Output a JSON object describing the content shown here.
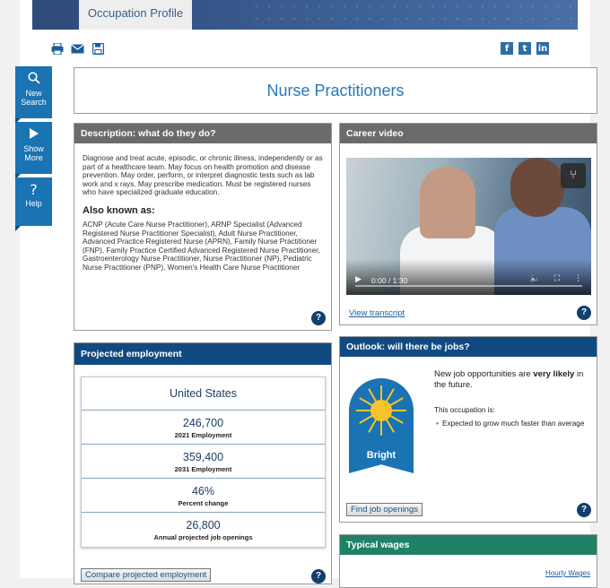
{
  "header": {
    "tab_label": "Occupation Profile"
  },
  "toolbar": {
    "left_icons": [
      "print-icon",
      "email-icon",
      "save-icon"
    ],
    "social": [
      "f",
      "t",
      "in"
    ]
  },
  "sidenav": [
    {
      "label_line1": "New",
      "label_line2": "Search",
      "icon": "search-icon"
    },
    {
      "label_line1": "Show",
      "label_line2": "More",
      "icon": "play-icon"
    },
    {
      "label_line1": "Help",
      "label_line2": "",
      "icon": "help-icon"
    }
  ],
  "page_title": "Nurse Practitioners",
  "description": {
    "heading": "Description: what do they do?",
    "text": "Diagnose and treat acute, episodic, or chronic illness, independently or as part of a healthcare team. May focus on health promotion and disease prevention. May order, perform, or interpret diagnostic tests such as lab work and x rays. May prescribe medication. Must be registered nurses who have specialized graduate education.",
    "aka_heading": "Also known as:",
    "aka_text": "ACNP (Acute Care Nurse Practitioner), ARNP Specialist (Advanced Registered Nurse Practitioner Specialist), Adult Nurse Practitioner, Advanced Practice Registered Nurse (APRN), Family Nurse Practitioner (FNP), Family Practice Certified Advanced Registered Nurse Practitioner, Gastroenterology Nurse Practitioner, Nurse Practitioner (NP), Pediatric Nurse Practitioner (PNP), Women's Health Care Nurse Practitioner"
  },
  "career_video": {
    "heading": "Career video",
    "time": "0:00 / 1:30",
    "transcript_link": "View transcript"
  },
  "projected": {
    "heading": "Projected employment",
    "region": "United States",
    "rows": [
      {
        "value": "246,700",
        "label": "2021 Employment"
      },
      {
        "value": "359,400",
        "label": "2031 Employment"
      },
      {
        "value": "46%",
        "label": "Percent change"
      },
      {
        "value": "26,800",
        "label": "Annual projected job openings"
      }
    ],
    "compare_button": "Compare projected employment"
  },
  "outlook": {
    "heading": "Outlook: will there be jobs?",
    "badge": "Bright",
    "text_pre": "New job opportunities are ",
    "text_bold": "very likely",
    "text_post": " in the future.",
    "sub": "This occupation is:",
    "bullet": "Expected to grow much faster than average",
    "find_button": "Find job openings"
  },
  "wages": {
    "heading": "Typical wages",
    "link": "Hourly Wages"
  },
  "help_glyph": "?",
  "colors": {
    "navy": "#114a80",
    "blue": "#1a73b2",
    "green": "#1f8166",
    "gray_head": "#6b6b6b",
    "title_blue": "#2977b8"
  }
}
